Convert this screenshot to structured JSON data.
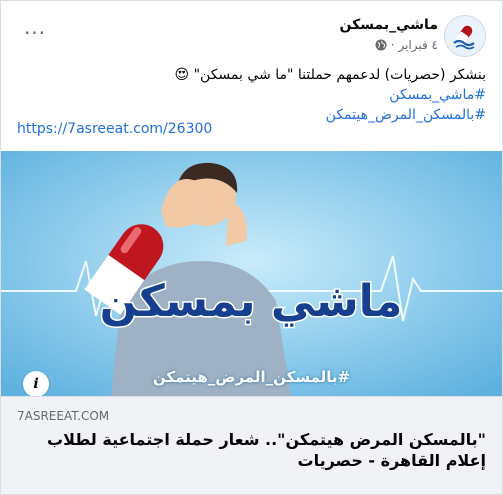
{
  "post": {
    "page_name": "ماشي_بمسكن",
    "date": "٤ فبراير",
    "separator": "·",
    "more_label": "···",
    "text_line1": "بنشكر (حصريات) لدعمهم حملتنا \"ما شي بمسكن\" 😍",
    "hashtag1": "#ماشي_بمسكن",
    "hashtag2": "#بالمسكن_المرض_هيتمكن",
    "link": "https://7asreeat.com/26300"
  },
  "image": {
    "watermark": "#بالمسكن_المرض_هيتمكن",
    "logo_text": "ماشي بمسكن",
    "info_label": "i"
  },
  "link_preview": {
    "domain": "7ASREEAT.COM",
    "title": "\"بالمسكن المرض هيتمكن\".. شعار حملة اجتماعية لطلاب إعلام القاهرة - حصريات"
  },
  "colors": {
    "link": "#216fdb",
    "image_bg": "#7fc4e8",
    "footer_bg": "#f0f2f5"
  },
  "icons": {
    "privacy": "globe-icon",
    "more": "more-dots-icon",
    "info": "info-icon"
  }
}
